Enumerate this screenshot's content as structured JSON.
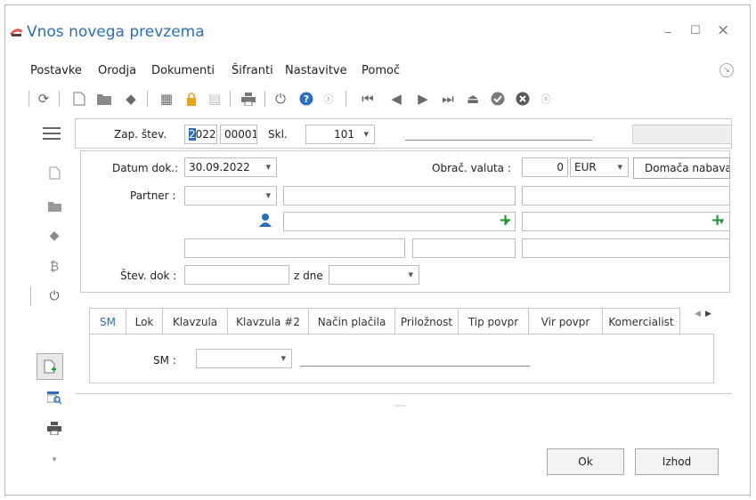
{
  "window": {
    "title": "Vnos novega prevzema",
    "minimize": "‒",
    "maximize": "☐",
    "close": "×"
  },
  "menu": {
    "items": [
      "Postavke",
      "Orodja",
      "Dokumenti",
      "Šifranti",
      "Nastavitve",
      "Pomoč"
    ]
  },
  "header": {
    "zap_label": "Zap. štev.",
    "year": "2022",
    "number": "00001",
    "skl_label": "Skl.",
    "skl_value": "101"
  },
  "form": {
    "datum_label": "Datum dok.:",
    "datum_value": "30.09.2022",
    "valuta_label": "Obrač. valuta :",
    "valuta_amount": "0",
    "valuta_currency": "EUR",
    "nabava_value": "Domača nabava",
    "partner_label": "Partner :",
    "stev_label": "Štev. dok :",
    "zdne_label": "z dne"
  },
  "tabs": [
    "SM",
    "Lok",
    "Klavzula",
    "Klavzula #2",
    "Način plačila",
    "Priložnost",
    "Tip povpr",
    "Vir povpr",
    "Komercialist"
  ],
  "sm": {
    "label": "SM :"
  },
  "buttons": {
    "ok": "Ok",
    "izhod": "Izhod"
  },
  "colors": {
    "accent": "#2a6fbf",
    "green": "#1a9a2f"
  }
}
